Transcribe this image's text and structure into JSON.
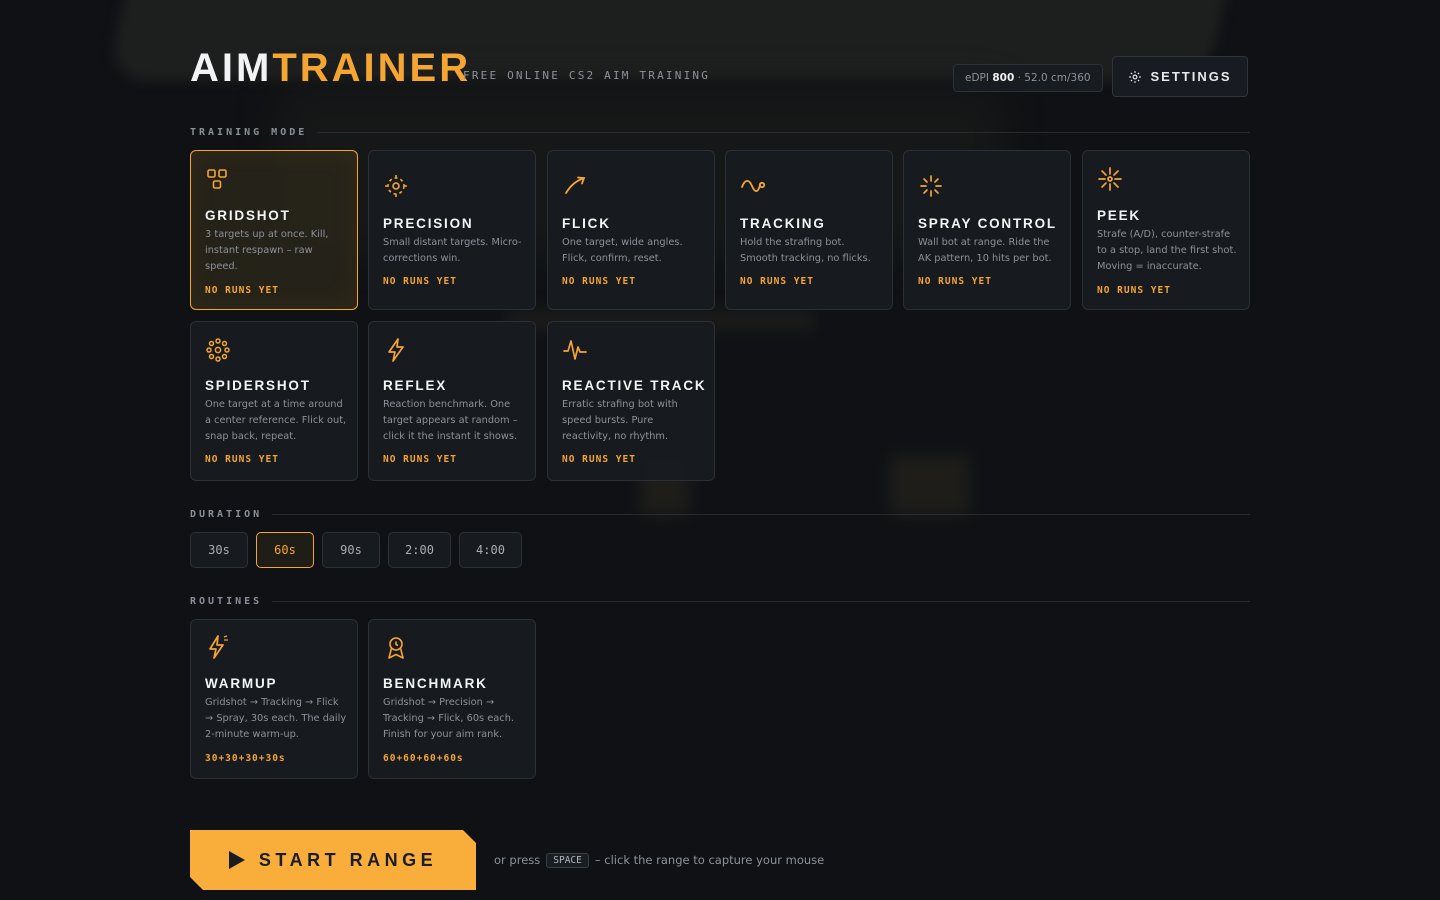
{
  "header": {
    "logo_part1": "AIM",
    "logo_part2": "TRAINER",
    "tagline": "FREE ONLINE CS2 AIM TRAINING",
    "edpi_label": "eDPI",
    "edpi_value": "800",
    "edpi_suffix": "· 52.0 cm/360",
    "settings_label": "SETTINGS"
  },
  "sections": {
    "mode": "TRAINING MODE",
    "duration": "DURATION",
    "routines": "ROUTINES"
  },
  "modes": [
    {
      "title": "GRIDSHOT",
      "desc": "3 targets up at once. Kill, instant respawn – raw speed.",
      "stat": "NO RUNS YET",
      "icon": "grid-icon",
      "selected": true
    },
    {
      "title": "PRECISION",
      "desc": "Small distant targets. Micro-corrections win.",
      "stat": "NO RUNS YET",
      "icon": "crosshair-icon"
    },
    {
      "title": "FLICK",
      "desc": "One target, wide angles. Flick, confirm, reset.",
      "stat": "NO RUNS YET",
      "icon": "flick-arrow-icon"
    },
    {
      "title": "TRACKING",
      "desc": "Hold the strafing bot. Smooth tracking, no flicks.",
      "stat": "NO RUNS YET",
      "icon": "wave-icon"
    },
    {
      "title": "SPRAY CONTROL",
      "desc": "Wall bot at range. Ride the AK pattern, 10 hits per bot.",
      "stat": "NO RUNS YET",
      "icon": "burst-icon"
    },
    {
      "title": "PEEK",
      "desc": "Strafe (A/D), counter-strafe to a stop, land the first shot. Moving = inaccurate.",
      "stat": "NO RUNS YET",
      "icon": "spark-icon"
    },
    {
      "title": "SPIDERSHOT",
      "desc": "One target at a time around a center reference. Flick out, snap back, repeat.",
      "stat": "NO RUNS YET",
      "icon": "spider-dots-icon"
    },
    {
      "title": "REFLEX",
      "desc": "Reaction benchmark. One target appears at random – click it the instant it shows.",
      "stat": "NO RUNS YET",
      "icon": "lightning-icon"
    },
    {
      "title": "REACTIVE TRACK",
      "desc": "Erratic strafing bot with speed bursts. Pure reactivity, no rhythm.",
      "stat": "NO RUNS YET",
      "icon": "pulse-icon"
    }
  ],
  "durations": [
    "30s",
    "60s",
    "90s",
    "2:00",
    "4:00"
  ],
  "selected_duration": "60s",
  "routines": [
    {
      "title": "WARMUP",
      "desc": "Gridshot → Tracking → Flick → Spray, 30s each. The daily 2-minute warm-up.",
      "stat": "30+30+30+30s",
      "icon": "bolt-spark-icon"
    },
    {
      "title": "BENCHMARK",
      "desc": "Gridshot → Precision → Tracking → Flick, 60s each. Finish for your aim rank.",
      "stat": "60+60+60+60s",
      "icon": "medal-icon"
    }
  ],
  "start": {
    "label": "START RANGE",
    "hint_prefix": "or press",
    "hint_key": "SPACE",
    "hint_suffix": "– click the range to capture your mouse"
  },
  "colors": {
    "accent": "#f5a532",
    "background": "#0f1114",
    "card": "#181b20"
  }
}
